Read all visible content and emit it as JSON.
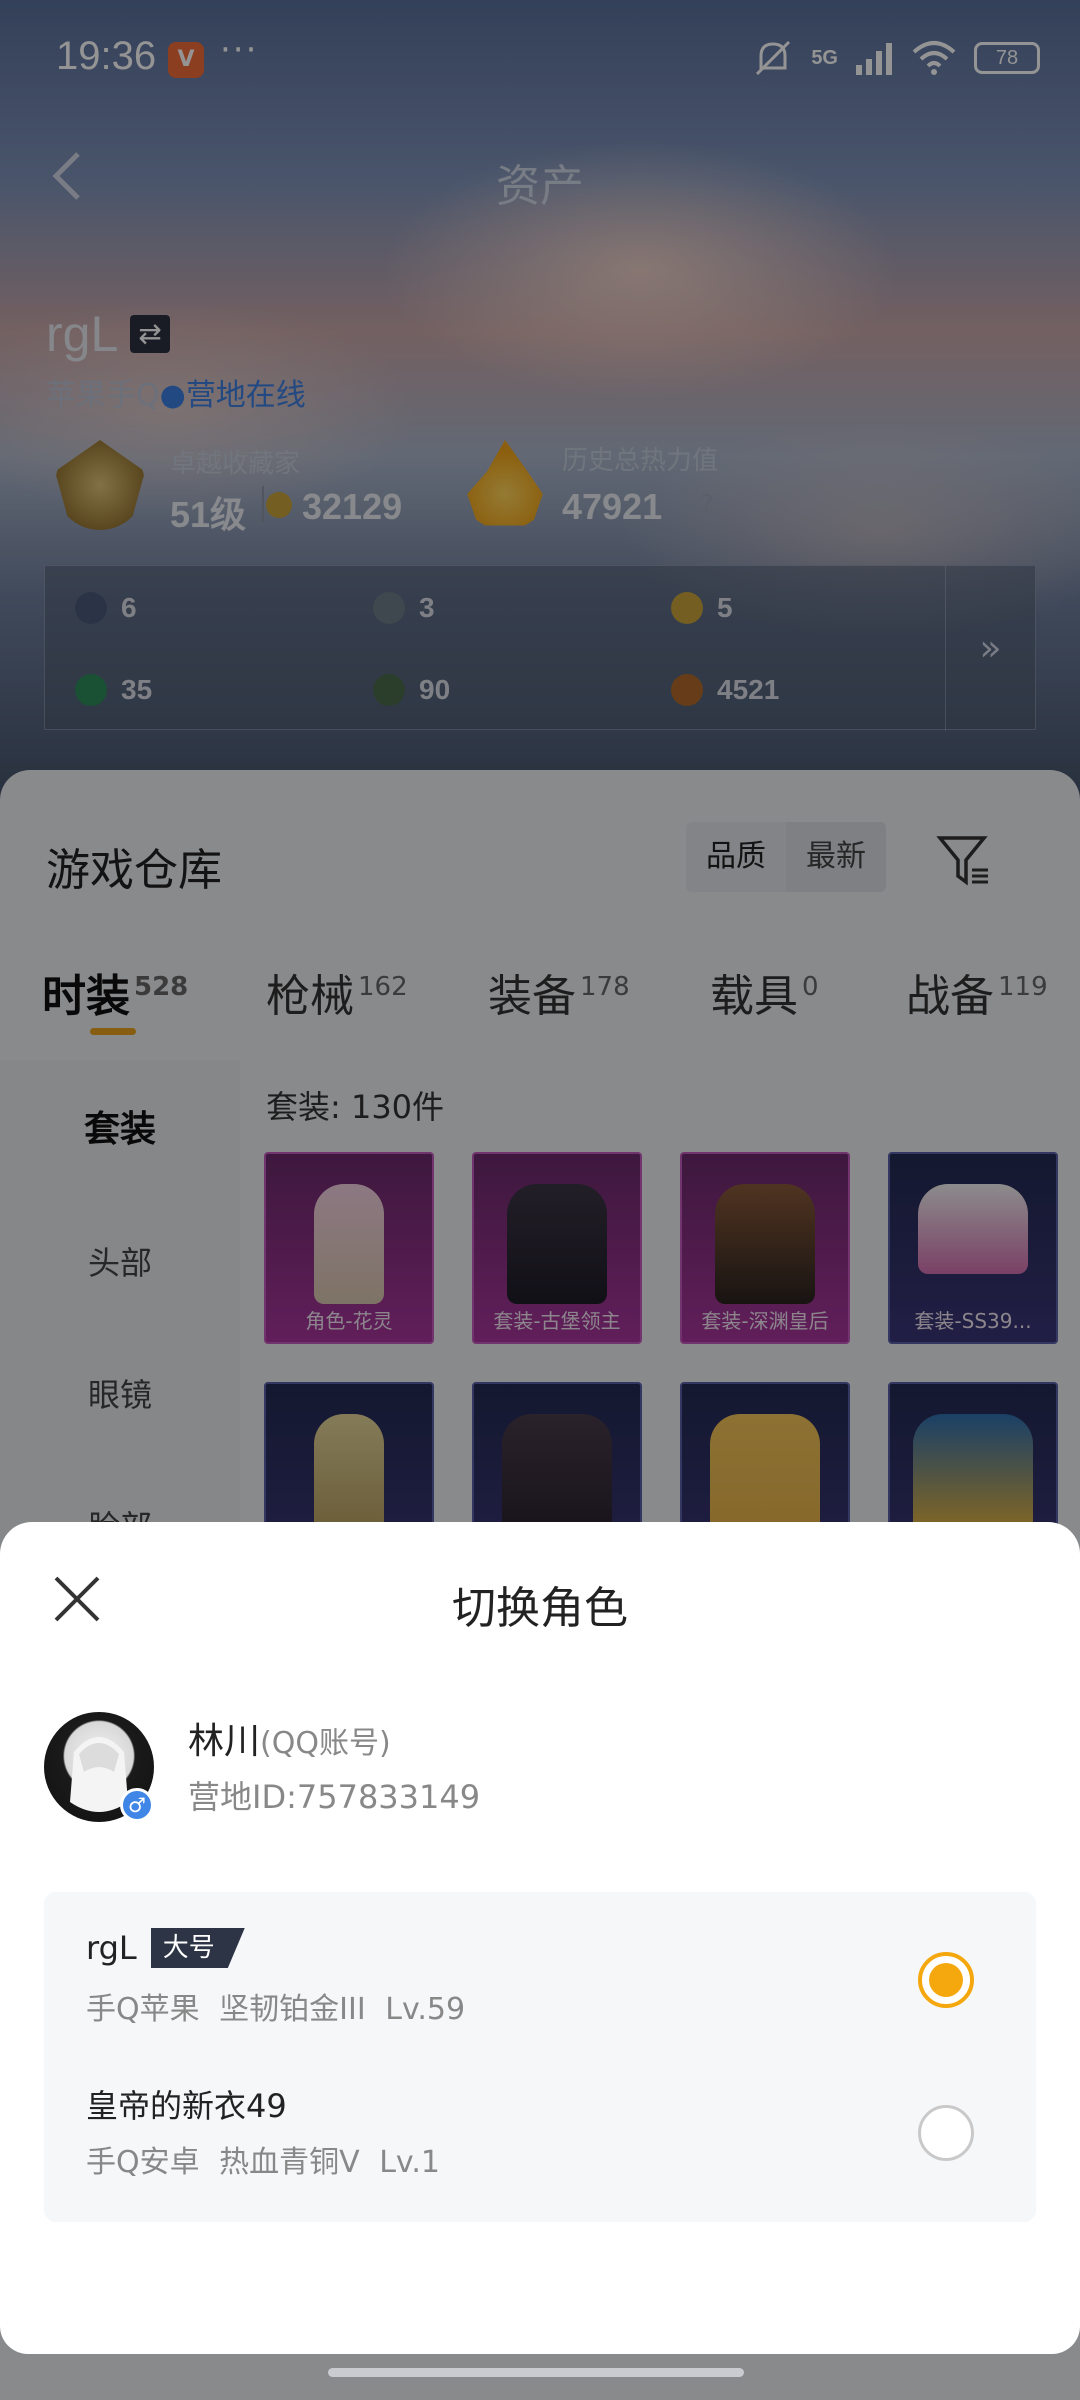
{
  "status_bar": {
    "time": "19:36",
    "app_icon_glyph": "V",
    "more": "···",
    "network": "5G",
    "battery": "78"
  },
  "header": {
    "title": "资产",
    "back_icon": "chevron-left-icon"
  },
  "profile": {
    "name": "rgL",
    "platform": "苹果手Q",
    "online_status": "营地在线"
  },
  "stats": {
    "collector_title": "卓越收藏家",
    "collector_level": "51级",
    "collector_points": "32129",
    "heat_title": "历史总热力值",
    "heat_value": "47921",
    "heat_help": "?"
  },
  "resources": [
    {
      "value": "6",
      "color": "#4b5a7a"
    },
    {
      "value": "3",
      "color": "#6d7b88"
    },
    {
      "value": "5",
      "color": "#c9a23a"
    },
    {
      "value": "35",
      "color": "#2e8a5a"
    },
    {
      "value": "90",
      "color": "#4a6a4a"
    },
    {
      "value": "4521",
      "color": "#b06a2a"
    }
  ],
  "resources_more": "»",
  "warehouse": {
    "title": "游戏仓库",
    "sort_quality": "品质",
    "sort_newest": "最新",
    "tabs": [
      {
        "label": "时装",
        "count": "528"
      },
      {
        "label": "枪械",
        "count": "162"
      },
      {
        "label": "装备",
        "count": "178"
      },
      {
        "label": "载具",
        "count": "0"
      },
      {
        "label": "战备",
        "count": "119"
      }
    ],
    "categories": [
      "套装",
      "头部",
      "眼镜",
      "脸部"
    ],
    "set_count": "套装: 130件",
    "items": [
      {
        "label": "角色-花灵"
      },
      {
        "label": "套装-古堡领主"
      },
      {
        "label": "套装-深渊皇后"
      },
      {
        "label": "套装-SS39..."
      },
      {
        "label": ""
      },
      {
        "label": ""
      },
      {
        "label": ""
      },
      {
        "label": ""
      }
    ]
  },
  "sheet": {
    "title": "切换角色",
    "account_name": "林川",
    "account_type": "(QQ账号)",
    "account_id": "营地ID:757833149",
    "gender_symbol": "♂",
    "roles": [
      {
        "name": "rgL",
        "tag": "大号",
        "detail": "手Q苹果 坚韧铂金III Lv.59",
        "selected": true
      },
      {
        "name": "皇帝的新衣49",
        "tag": "",
        "detail": "手Q安卓 热血青铜V Lv.1",
        "selected": false
      }
    ]
  }
}
